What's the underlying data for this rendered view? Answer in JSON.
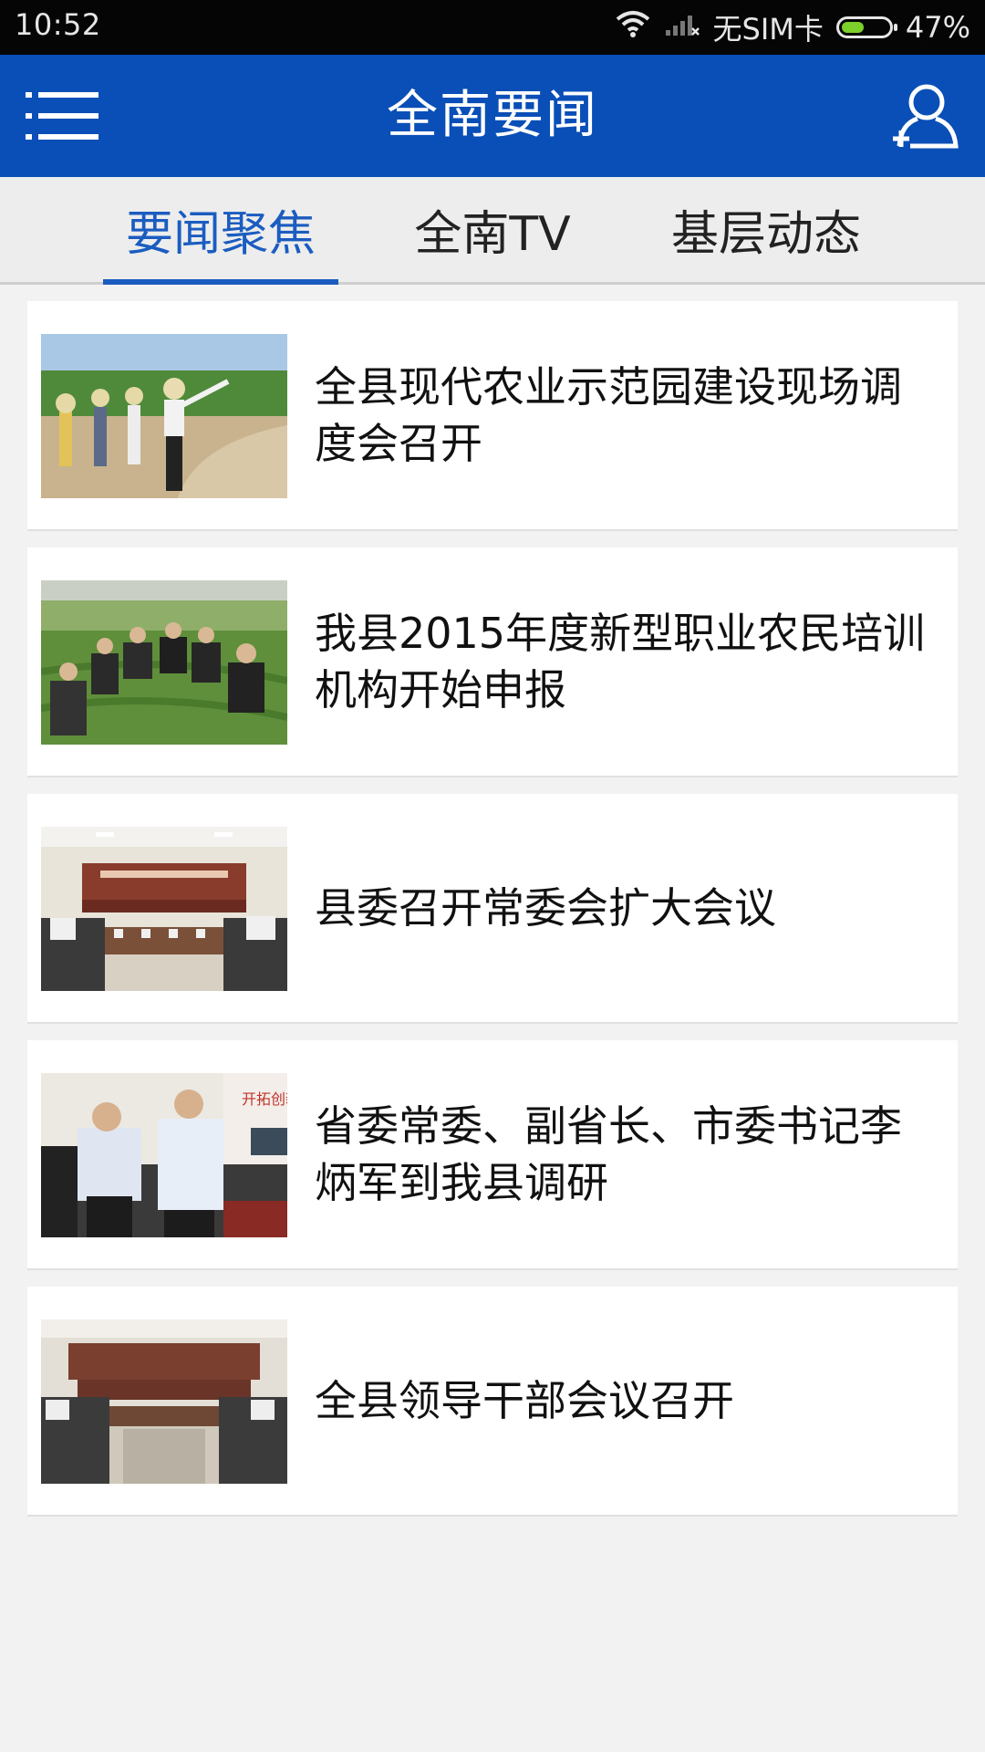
{
  "status_bar": {
    "time": "10:52",
    "carrier": "无SIM卡",
    "battery_percent": "47%",
    "battery_level": 0.47,
    "icons": [
      "wifi-icon",
      "signal-icon",
      "battery-icon"
    ]
  },
  "app_bar": {
    "title": "全南要闻",
    "background_color": "#0a4eb8",
    "left_icon": "menu-icon",
    "right_icon": "user-add-icon"
  },
  "tabs": [
    {
      "label": "要闻聚焦",
      "active": true
    },
    {
      "label": "全南TV",
      "active": false
    },
    {
      "label": "基层动态",
      "active": false
    }
  ],
  "accent_color": "#1a5cc0",
  "news": [
    {
      "title": "全县现代农业示范园建设现场调度会召开",
      "image": "photo-field-visit"
    },
    {
      "title": "我县2015年度新型职业农民培训机构开始申报",
      "image": "photo-tea-garden"
    },
    {
      "title": "县委召开常委会扩大会议",
      "image": "photo-meeting-hall"
    },
    {
      "title": "省委常委、副省长、市委书记李炳军到我县调研",
      "image": "photo-officials-inspection"
    },
    {
      "title": "全县领导干部会议召开",
      "image": "photo-meeting-room"
    }
  ]
}
